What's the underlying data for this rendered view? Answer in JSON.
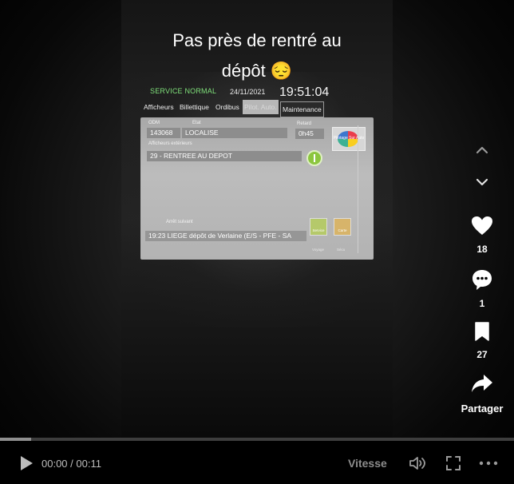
{
  "video": {
    "caption_line1": "Pas près de rentré au",
    "caption_line2": "dépôt 😔"
  },
  "device_screen": {
    "status": "SERVICE NORMAL",
    "date": "24/11/2021",
    "time": "19:51:04",
    "tabs": [
      "Afficheurs",
      "Billettique",
      "Ordibus",
      "Pilot. Auto.",
      "Maintenance"
    ],
    "odm_label": "ODM",
    "odm_value": "143068",
    "etat_label": "Etat",
    "etat_value": "LOCALISE",
    "retard_label": "Retard",
    "retard_value": "0h45",
    "afficheurs_label": "Afficheurs extérieurs",
    "afficheurs_value": "29 - RENTREE AU DEPOT",
    "pilot_button_label": "Pilotage Sur Auto",
    "arret_label": "Arrêt suivant",
    "arret_value": "19:23   LIEGE dépôt de Verlaine (E/S - PFE - SA",
    "btn_a_label": "Service",
    "btn_b_label": "Carte",
    "btn_c_label": "Voyage",
    "btn_d_label": "Sécu"
  },
  "actions": {
    "likes": "18",
    "comments": "1",
    "bookmarks": "27",
    "share_label": "Partager"
  },
  "player": {
    "time": "00:00 / 00:11",
    "speed_label": "Vitesse",
    "progress": 0.06
  },
  "colors": {
    "status_green": "#7fe07a",
    "info_green": "#8cc63f",
    "background": "#000000"
  },
  "icons": [
    "chevron-up-icon",
    "chevron-down-icon",
    "heart-icon",
    "comment-icon",
    "bookmark-icon",
    "share-icon",
    "play-icon",
    "volume-icon",
    "fullscreen-icon",
    "more-icon",
    "info-icon"
  ]
}
